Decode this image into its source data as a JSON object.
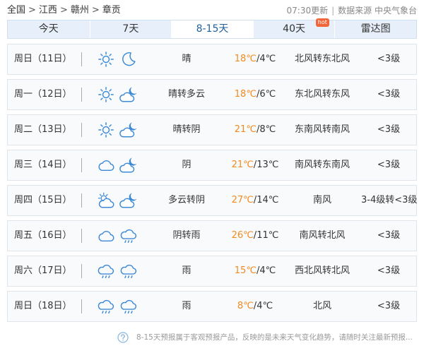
{
  "breadcrumb": {
    "items": [
      "全国",
      "江西",
      "赣州",
      "章贡"
    ],
    "separator": ">"
  },
  "header": {
    "update_time": "07:30更新",
    "divider": "|",
    "source": "数据来源 中央气象台"
  },
  "tabs": [
    {
      "label": "今天",
      "active": false
    },
    {
      "label": "7天",
      "active": false
    },
    {
      "label": "8-15天",
      "active": true
    },
    {
      "label": "40天",
      "active": false,
      "badge": "hot"
    },
    {
      "label": "雷达图",
      "active": false
    }
  ],
  "temp_separator": "/",
  "forecast": [
    {
      "day": "周日（11日）",
      "icon_day": "sun-icon",
      "icon_night": "moon-icon",
      "weather": "晴",
      "high": "18℃",
      "low": "4℃",
      "wind": "北风转东北风",
      "level": "<3级"
    },
    {
      "day": "周一（12日）",
      "icon_day": "sun-icon",
      "icon_night": "cloud-moon-icon",
      "weather": "晴转多云",
      "high": "18℃",
      "low": "6℃",
      "wind": "东北风转东风",
      "level": "<3级"
    },
    {
      "day": "周二（13日）",
      "icon_day": "sun-icon",
      "icon_night": "cloud-moon-icon",
      "weather": "晴转阴",
      "high": "21℃",
      "low": "8℃",
      "wind": "东南风转南风",
      "level": "<3级"
    },
    {
      "day": "周三（14日）",
      "icon_day": "cloud-icon",
      "icon_night": "cloud-moon-icon",
      "weather": "阴",
      "high": "21℃",
      "low": "13℃",
      "wind": "南风转东南风",
      "level": "<3级"
    },
    {
      "day": "周四（15日）",
      "icon_day": "cloud-sun-icon",
      "icon_night": "cloud-moon-icon",
      "weather": "多云转阴",
      "high": "27℃",
      "low": "14℃",
      "wind": "南风",
      "level": "3-4级转<3级"
    },
    {
      "day": "周五（16日）",
      "icon_day": "cloud-icon",
      "icon_night": "rain-icon",
      "weather": "阴转雨",
      "high": "26℃",
      "low": "11℃",
      "wind": "南风转北风",
      "level": "<3级"
    },
    {
      "day": "周六（17日）",
      "icon_day": "rain-icon",
      "icon_night": "rain-icon",
      "weather": "雨",
      "high": "15℃",
      "low": "4℃",
      "wind": "西北风转北风",
      "level": "<3级"
    },
    {
      "day": "周日（18日）",
      "icon_day": "rain-icon",
      "icon_night": "rain-icon",
      "weather": "雨",
      "high": "8℃",
      "low": "4℃",
      "wind": "北风",
      "level": "<3级"
    }
  ],
  "footer": {
    "icon": "question-icon",
    "note": "8-15天预报属于客观预报产品，反映的是未来天气变化趋势，请随时关注最新预报..."
  },
  "colors": {
    "accent": "#3d8ad6",
    "high_temp": "#f28a1e",
    "tab_background": "#e7f0fa",
    "hot_badge": "#f0663a"
  }
}
